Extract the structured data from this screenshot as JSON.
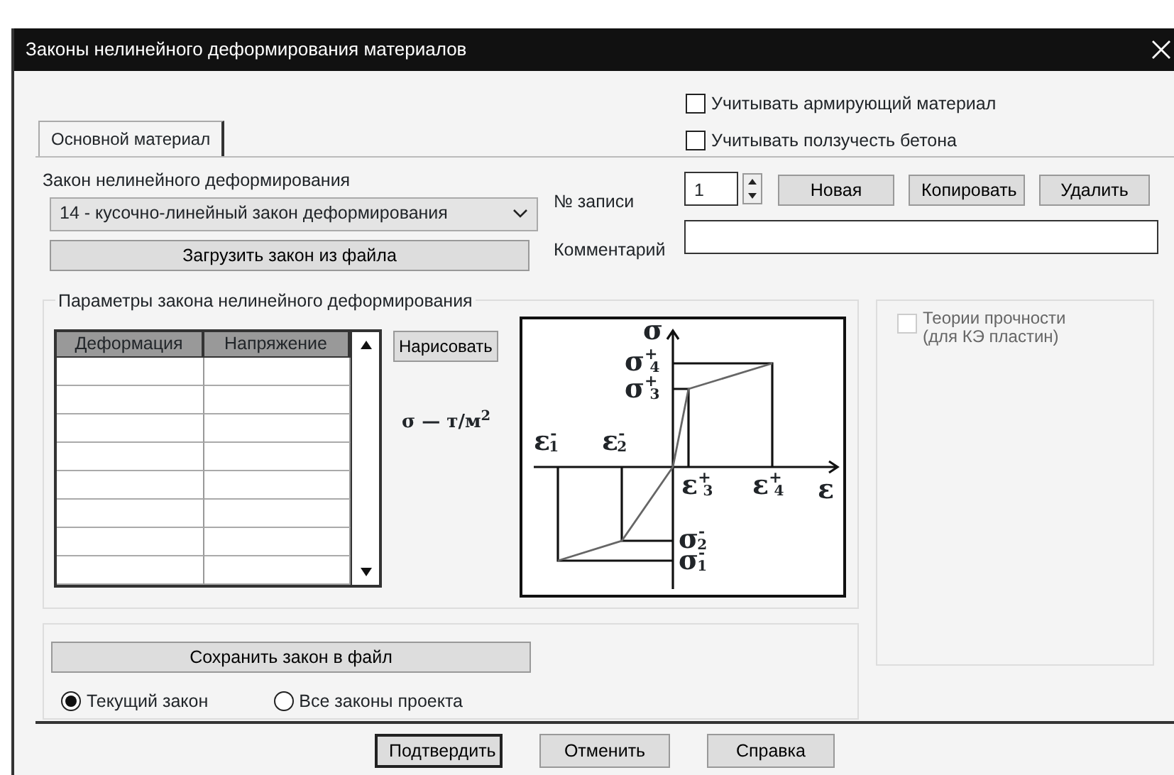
{
  "window": {
    "title": "Законы нелинейного деформирования материалов"
  },
  "options": [
    {
      "label": "Учитывать армирующий материал",
      "checked": false
    },
    {
      "label": "Учитывать ползучесть бетона",
      "checked": false
    }
  ],
  "tabs": [
    {
      "label": "Основной материал",
      "selected": true
    }
  ],
  "law": {
    "label": "Закон нелинейного деформирования",
    "value": "14 - кусочно-линейный закон деформирования",
    "load_button": "Загрузить закон из файла"
  },
  "record": {
    "label": "№ записи",
    "value": "1",
    "buttons": [
      "Новая",
      "Копировать",
      "Удалить"
    ]
  },
  "comment": {
    "label": "Комментарий"
  },
  "parameters": {
    "title": "Параметры закона нелинейного деформирования",
    "columns": [
      "Деформация",
      "Напряжение"
    ],
    "draw_button": "Нарисовать",
    "units": "σ — т/м$^{2}$",
    "diagram_labels": [
      "σ",
      "σ$^{+}$$_{4}$",
      "σ$^{+}$$_{3}$",
      "ε$^{-}$$_{1}$",
      "ε$^{-}$$_{2}$",
      "ε$^{+}$$_{3}$",
      "ε$^{+}$$_{4}$",
      "ε",
      "σ$^{-}$$_{2}$",
      "σ$^{-}$$_{1}$"
    ]
  },
  "strength": {
    "label": "Теории прочности (для КЭ пластин)",
    "checked": false,
    "disabled": true
  },
  "save": {
    "button": "Сохранить закон в файл",
    "options": [
      {
        "label": "Текущий закон",
        "selected": true
      },
      {
        "label": "Все законы проекта",
        "selected": false
      }
    ]
  },
  "buttons": [
    {
      "label": "Подтвердить",
      "default": true
    },
    {
      "label": "Отменить",
      "default": false
    },
    {
      "label": "Справка",
      "default": false
    }
  ]
}
